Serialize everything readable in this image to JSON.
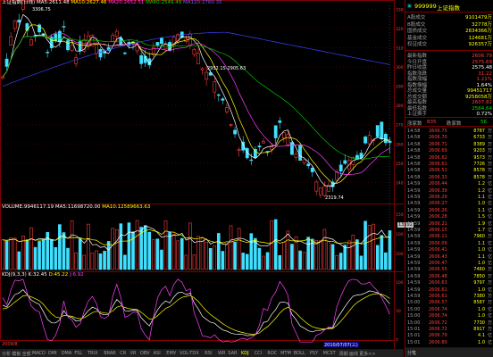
{
  "main_header": {
    "title": "上证指数(日线)",
    "ma5": "MA5:2611.48",
    "ma10": "MA10:2627.46",
    "ma20": "MA20:2652.51",
    "ma60": "MA60:2549.49",
    "ma120": "MA120:2760.35"
  },
  "price_annotations": {
    "high_label": "3306.75",
    "mid_label": "2952.15-2905.63",
    "low_label": "2319.74"
  },
  "price_axis": [
    "3300",
    "3200",
    "3100",
    "3000",
    "2900",
    "2800",
    "2700",
    "2600",
    "2500",
    "2400"
  ],
  "volume_header": {
    "title": "VOLUME:9946117.19",
    "ma5": "MA5:11698720.00",
    "ma10": "MA10:12589663.63"
  },
  "volume_axis": [
    "15000",
    "10000",
    "5000"
  ],
  "volume_side_label": "13192",
  "kdj_header": {
    "title": "KDJ(9,3,3)",
    "k": "K:32.45",
    "d": "D:45.22",
    "j": "J:6.92"
  },
  "kdj_axis": [
    "100",
    "50",
    "0"
  ],
  "date_labels": [
    "2009/8",
    "2010/07/07(三)"
  ],
  "bottom_tabs": [
    "分析",
    "模板",
    "全部",
    "MACD",
    "DMI",
    "DMA",
    "FSL",
    "TRIX",
    "BRAR",
    "CR",
    "VR",
    "OBV",
    "ASI",
    "EMV",
    "VOL-TDX",
    "RSI",
    "WR",
    "SAR",
    "KDJ",
    "CCI",
    "ROC",
    "MTM",
    "BOLL",
    "PSY",
    "MCST",
    "周期",
    "画线",
    "更多>>"
  ],
  "side": {
    "code": "999999",
    "name": "上证指数",
    "stats": [
      {
        "label": "A股成交",
        "value": "9101479万",
        "color": "#ffff00"
      },
      {
        "label": "B股成交",
        "value": "32778万",
        "color": "#ffff00"
      },
      {
        "label": "国债成交",
        "value": "2834366万",
        "color": "#ffff00"
      },
      {
        "label": "基金成交",
        "value": "124681万",
        "color": "#ffff00"
      },
      {
        "label": "权证成交",
        "value": "926357万",
        "color": "#ffff00"
      }
    ],
    "quote": [
      {
        "label": "最新指数",
        "value": "2606.79",
        "color": "#ff3c3c"
      },
      {
        "label": "今日开盘",
        "value": "2575.69",
        "color": "#ff3c3c"
      },
      {
        "label": "昨日收盘",
        "value": "2575.48",
        "color": "#ffffff"
      },
      {
        "label": "指数涨跌",
        "value": "31.22",
        "color": "#ff3c3c"
      },
      {
        "label": "指数涨幅",
        "value": "1.21%",
        "color": "#ff3c3c"
      },
      {
        "label": "指数振幅",
        "value": "1.64%",
        "color": "#ffffff"
      },
      {
        "label": "总成交量",
        "value": "99451717",
        "color": "#ffff00"
      },
      {
        "label": "总成交额",
        "value": "9258058万",
        "color": "#ffff00"
      },
      {
        "label": "最高指数",
        "value": "2607.82",
        "color": "#ff3c3c"
      },
      {
        "label": "最低指数",
        "value": "2564.64",
        "color": "#00e000"
      },
      {
        "label": "上证换手",
        "value": "0.72%",
        "color": "#ffffff"
      }
    ],
    "rise_fall": {
      "label1": "涨家数",
      "val1": "835",
      "label2": "跌家数",
      "val2": "56"
    },
    "ticks": [
      {
        "time": "14:58",
        "price": "2606.75",
        "vol": "8787",
        "unit": "万"
      },
      {
        "time": "14:58",
        "price": "2606.70",
        "vol": "6733",
        "unit": "万"
      },
      {
        "time": "14:58",
        "price": "2606.71",
        "vol": "8389",
        "unit": "万"
      },
      {
        "time": "14:58",
        "price": "2606.69",
        "vol": "9203",
        "unit": "万"
      },
      {
        "time": "14:58",
        "price": "2606.62",
        "vol": "9573",
        "unit": "万"
      },
      {
        "time": "14:58",
        "price": "2606.61",
        "vol": "7726",
        "unit": "万"
      },
      {
        "time": "14:58",
        "price": "2606.51",
        "vol": "8578",
        "unit": "万"
      },
      {
        "time": "14:58",
        "price": "2606.33",
        "vol": "8578",
        "unit": "万"
      },
      {
        "time": "14:59",
        "price": "2606.44",
        "vol": "1.2",
        "unit": "亿"
      },
      {
        "time": "14:59",
        "price": "2606.39",
        "vol": "1.2",
        "unit": "亿"
      },
      {
        "time": "14:59",
        "price": "2606.29",
        "vol": "1.1",
        "unit": "亿"
      },
      {
        "time": "14:59",
        "price": "2606.27",
        "vol": "1.0",
        "unit": "亿"
      },
      {
        "time": "14:59",
        "price": "2606.26",
        "vol": "1.1",
        "unit": "亿"
      },
      {
        "time": "14:59",
        "price": "2606.28",
        "vol": "1.5",
        "unit": "亿"
      },
      {
        "time": "14:59",
        "price": "2606.21",
        "vol": "1.9",
        "unit": "亿"
      },
      {
        "time": "14:59",
        "price": "2606.15",
        "vol": "1.7",
        "unit": "亿"
      },
      {
        "time": "14:59",
        "price": "2606.11",
        "vol": "7960",
        "unit": "万"
      },
      {
        "time": "14:59",
        "price": "2606.09",
        "vol": "1.1",
        "unit": "亿"
      },
      {
        "time": "14:59",
        "price": "2606.41",
        "vol": "1.0",
        "unit": "亿"
      },
      {
        "time": "14:59",
        "price": "2606.43",
        "vol": "1.1",
        "unit": "亿"
      },
      {
        "time": "14:59",
        "price": "2606.47",
        "vol": "1.0",
        "unit": "亿"
      },
      {
        "time": "14:59",
        "price": "2606.55",
        "vol": "7460",
        "unit": "万"
      },
      {
        "time": "14:59",
        "price": "2606.48",
        "vol": "7850",
        "unit": "万"
      },
      {
        "time": "14:59",
        "price": "2606.63",
        "vol": "9797",
        "unit": "万"
      },
      {
        "time": "14:59",
        "price": "2606.61",
        "vol": "1.0",
        "unit": "亿"
      },
      {
        "time": "14:59",
        "price": "2606.61",
        "vol": "7380",
        "unit": "万"
      },
      {
        "time": "15:00",
        "price": "2606.57",
        "vol": "8587",
        "unit": "万"
      },
      {
        "time": "15:00",
        "price": "2606.74",
        "vol": "1.0",
        "unit": "亿"
      },
      {
        "time": "15:00",
        "price": "2606.74",
        "vol": "1.0",
        "unit": "亿"
      },
      {
        "time": "15:00",
        "price": "2606.72",
        "vol": "7730",
        "unit": "万"
      },
      {
        "time": "15:01",
        "price": "2606.72",
        "vol": "8917",
        "unit": "万"
      },
      {
        "time": "15:01",
        "price": "2606.79",
        "vol": "4.1",
        "unit": "亿"
      },
      {
        "time": "15:01",
        "price": "2606.80",
        "vol": "1.0",
        "unit": "亿"
      }
    ],
    "tab_label": "分笔"
  },
  "colors": {
    "up": "#ff3c3c",
    "down": "#40e0ff",
    "ma5": "#ffffff",
    "ma10": "#ffff00",
    "ma20": "#ff40ff",
    "ma60": "#00c000",
    "ma120": "#4040ff",
    "grid": "#800000"
  },
  "chart_data": {
    "type": "candlestick",
    "title": "上证指数(日线)",
    "y_range": [
      2300,
      3320
    ],
    "last_close": 2606.79,
    "high": 3306.75,
    "low": 2319.74,
    "kdj": {
      "k": 32.45,
      "d": 45.22,
      "j": 6.92
    }
  }
}
